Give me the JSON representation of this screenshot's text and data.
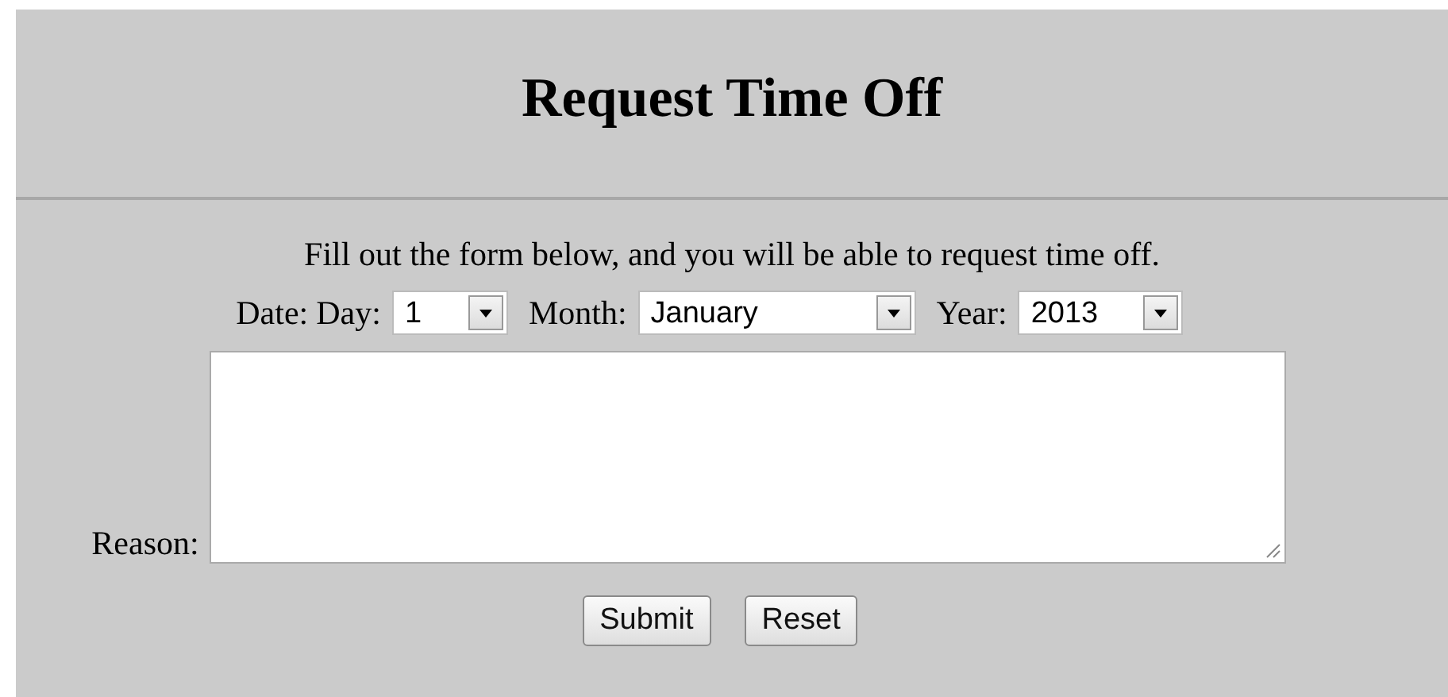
{
  "title": "Request Time Off",
  "intro": "Fill out the form below, and you will be able to request time off.",
  "date": {
    "label": "Date:",
    "fields": [
      {
        "kind": "day",
        "label": "Day:",
        "value": "1"
      },
      {
        "kind": "month",
        "label": "Month:",
        "value": "January"
      },
      {
        "kind": "year",
        "label": "Year:",
        "value": "2013"
      }
    ]
  },
  "reason": {
    "label": "Reason:"
  },
  "buttons": [
    "Submit",
    "Reset"
  ]
}
